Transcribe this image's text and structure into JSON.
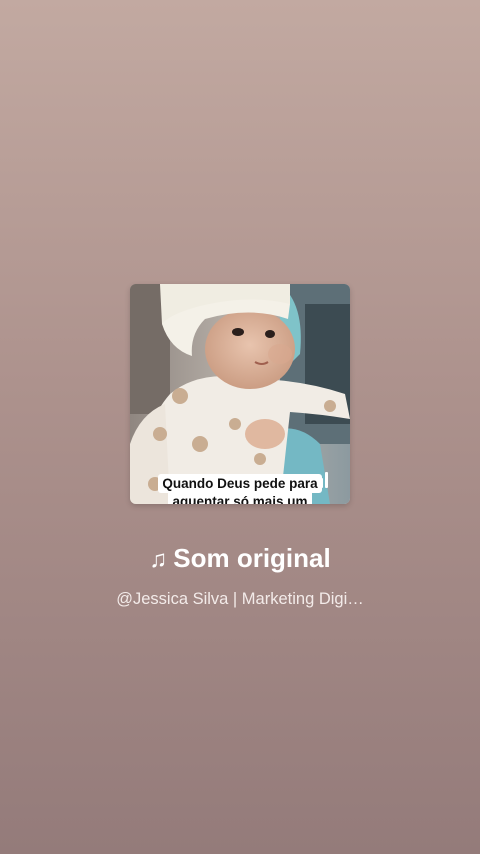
{
  "cover": {
    "caption_line1": "Quando Deus pede para",
    "caption_line2": "aguentar só mais um"
  },
  "sound": {
    "icon": "music-note-icon",
    "note_glyph": "♫",
    "title": "Som original",
    "author": "@Jessica Silva | Marketing Digi…"
  },
  "colors": {
    "background_top": "#c2a9a1",
    "background_bottom": "#947b7a",
    "text": "#ffffff"
  }
}
